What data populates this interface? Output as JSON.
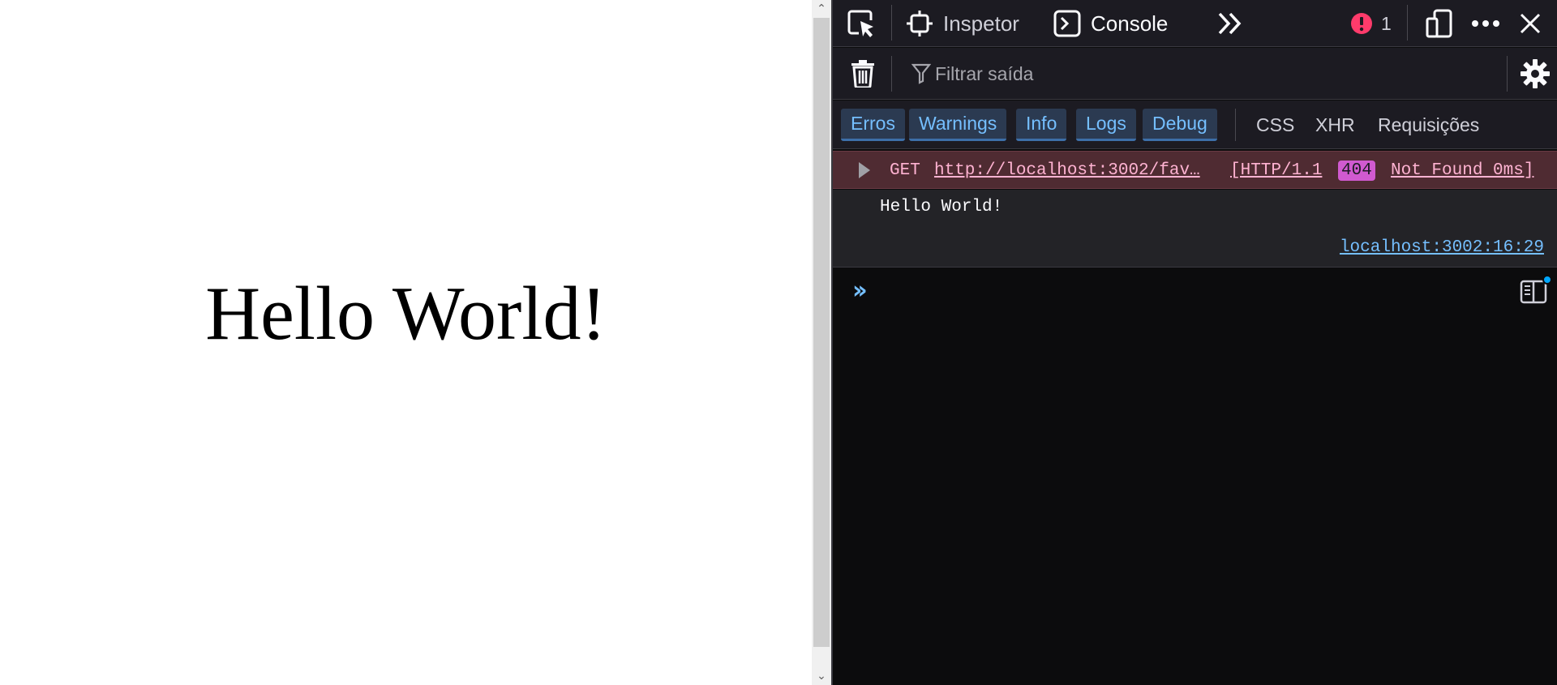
{
  "page": {
    "heading": "Hello World!"
  },
  "devtools": {
    "toolbar": {
      "inspector_label": "Inspetor",
      "console_label": "Console",
      "error_count": "1"
    },
    "filter": {
      "placeholder": "Filtrar saída"
    },
    "levels": [
      "Erros",
      "Warnings",
      "Info",
      "Logs",
      "Debug"
    ],
    "request_filters": [
      "CSS",
      "XHR",
      "Requisições"
    ],
    "messages": {
      "error": {
        "method": "GET",
        "url": "http://localhost:3002/fav…",
        "protocol": "[HTTP/1.1",
        "status_code": "404",
        "status_text": "Not Found 0ms]"
      },
      "log": {
        "text": "Hello World!",
        "location": "localhost:3002:16:29"
      }
    }
  },
  "colors": {
    "accent": "#75bfff",
    "error_background": "#4f2b32",
    "error_text": "#ffb3d2",
    "badge": "#d05ad0",
    "error_icon": "#ff3b6b"
  }
}
